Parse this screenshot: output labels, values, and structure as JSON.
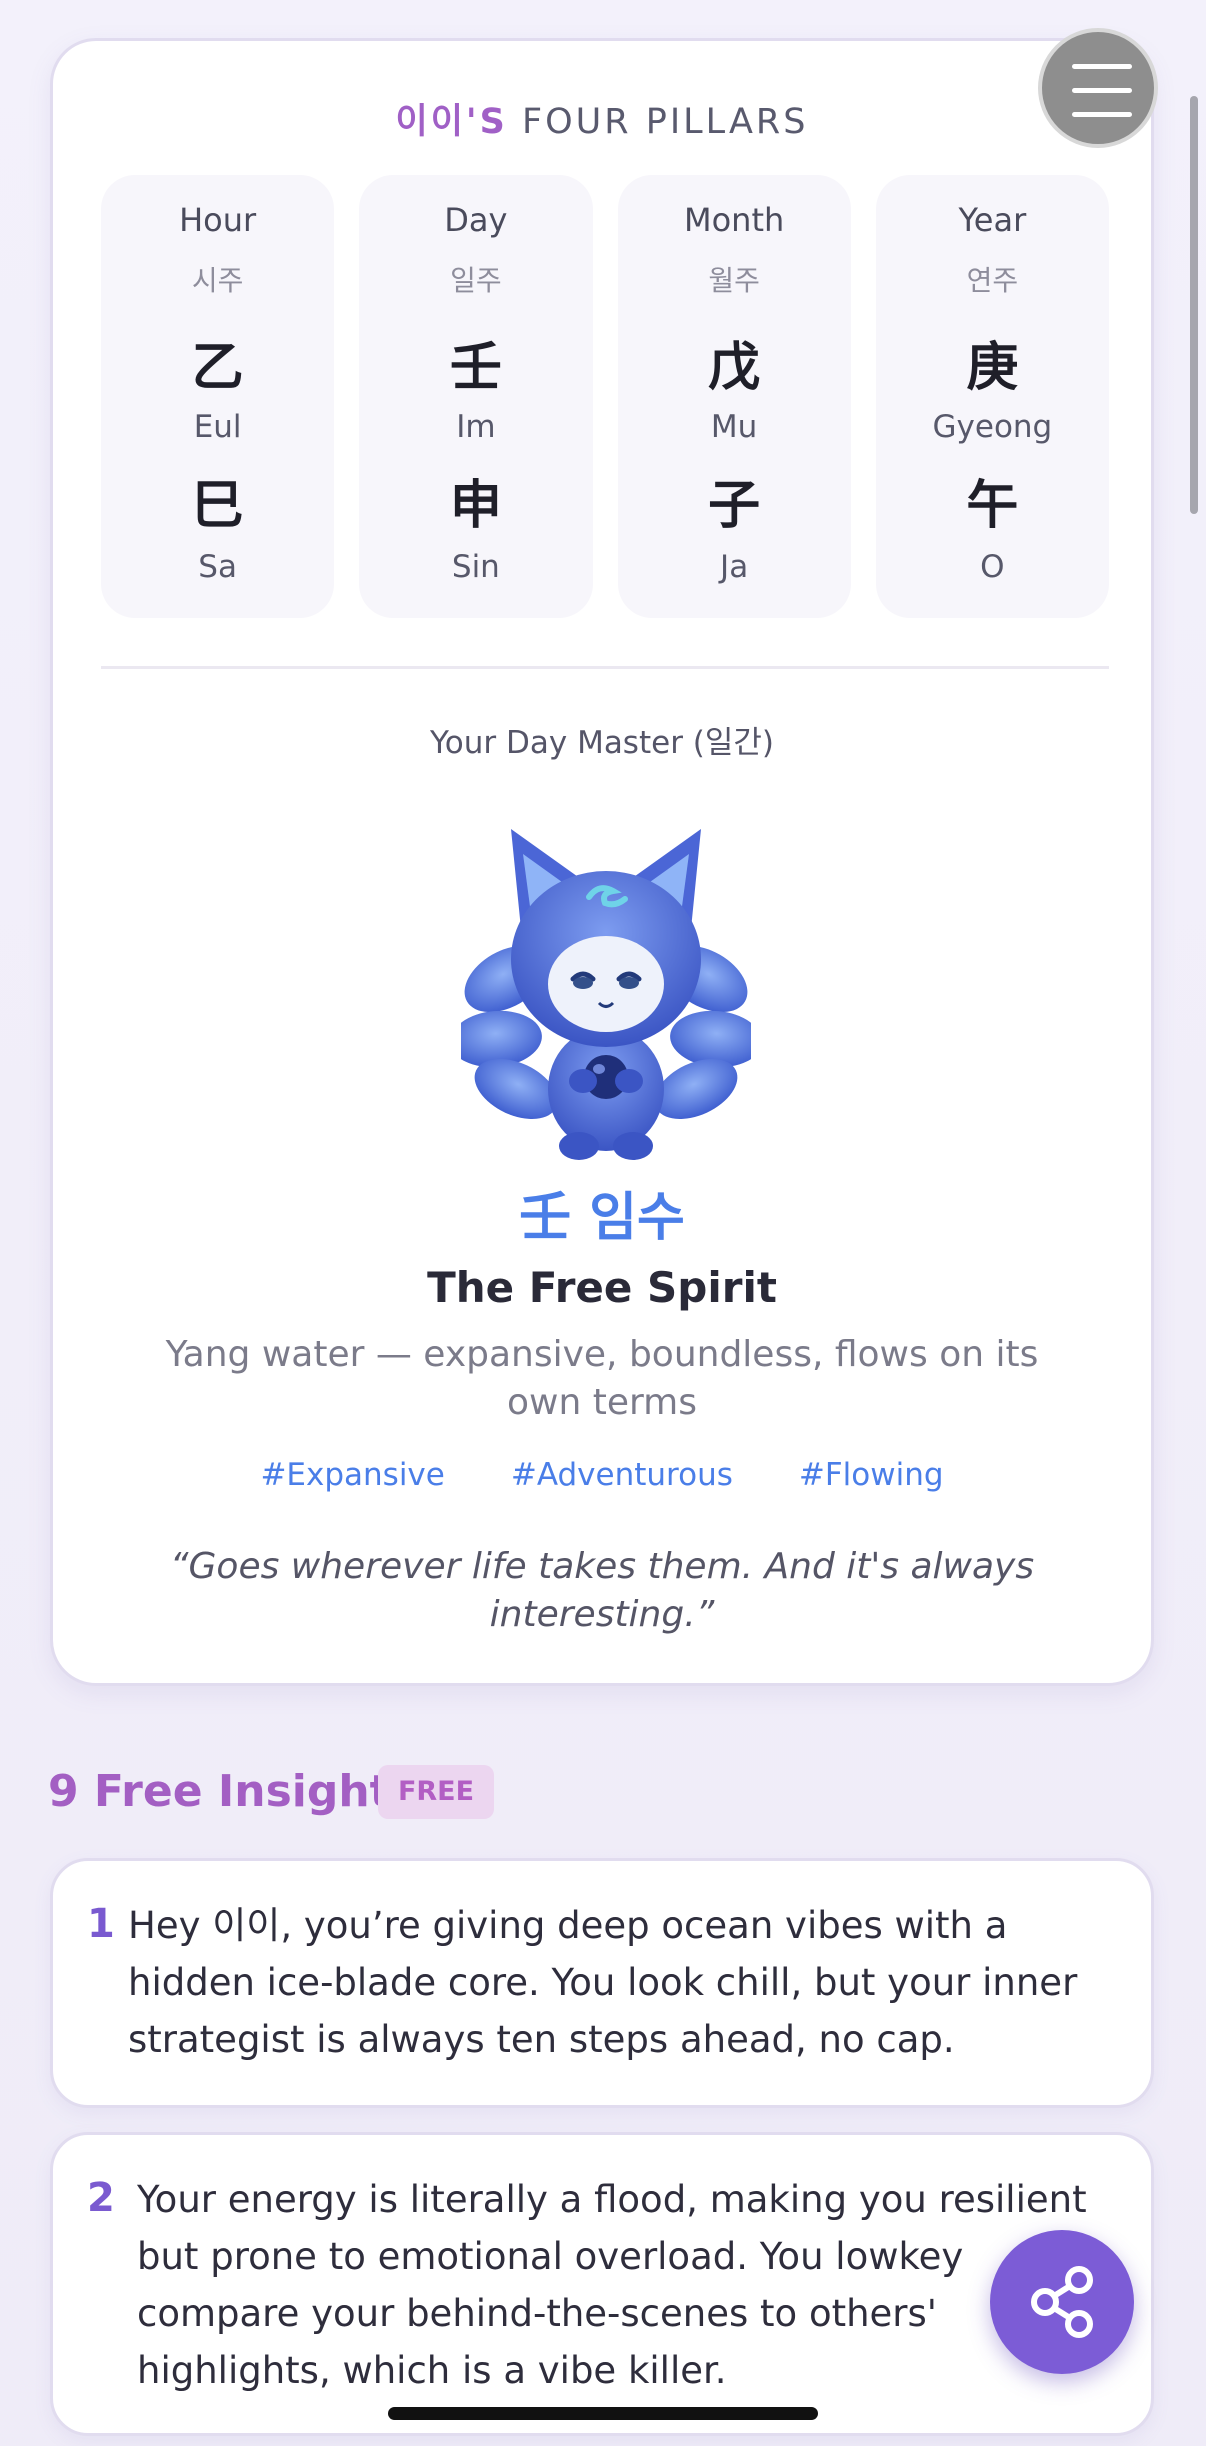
{
  "header": {
    "owner": "이이'S",
    "title": "FOUR PILLARS"
  },
  "pillars": [
    {
      "label": "Hour",
      "korean": "시주",
      "stem_hanja": "乙",
      "stem_roman": "Eul",
      "branch_hanja": "巳",
      "branch_roman": "Sa"
    },
    {
      "label": "Day",
      "korean": "일주",
      "stem_hanja": "壬",
      "stem_roman": "Im",
      "branch_hanja": "申",
      "branch_roman": "Sin"
    },
    {
      "label": "Month",
      "korean": "월주",
      "stem_hanja": "戊",
      "stem_roman": "Mu",
      "branch_hanja": "子",
      "branch_roman": "Ja"
    },
    {
      "label": "Year",
      "korean": "연주",
      "stem_hanja": "庚",
      "stem_roman": "Gyeong",
      "branch_hanja": "午",
      "branch_roman": "O"
    }
  ],
  "day_master": {
    "label": "Your Day Master (일간)",
    "hanja_name": "壬 임수",
    "title": "The Free Spirit",
    "description": "Yang water — expansive, boundless, flows on its own terms",
    "tags": [
      "#Expansive",
      "#Adventurous",
      "#Flowing"
    ],
    "quote": "“Goes wherever life takes them. And it's always interesting.”",
    "mascot_icon": "water-fox-mascot"
  },
  "insights_section": {
    "title": "9 Free Insights",
    "badge": "FREE",
    "items": [
      {
        "number": "1",
        "text": "Hey 이이, you’re giving deep ocean vibes with a hidden ice-blade core. You look chill, but your inner strategist is always ten steps ahead, no cap."
      },
      {
        "number": "2",
        "text": "Your energy is literally a flood, making you resilient but prone to emotional overload. You lowkey compare your behind-the-scenes to others' highlights, which is a vibe killer."
      }
    ]
  },
  "icons": {
    "menu": "hamburger-menu-icon",
    "share": "share-icon"
  },
  "colors": {
    "accent_purple": "#a35fc3",
    "accent_blue": "#4a7ee8",
    "share_button": "#7c5cd6"
  }
}
